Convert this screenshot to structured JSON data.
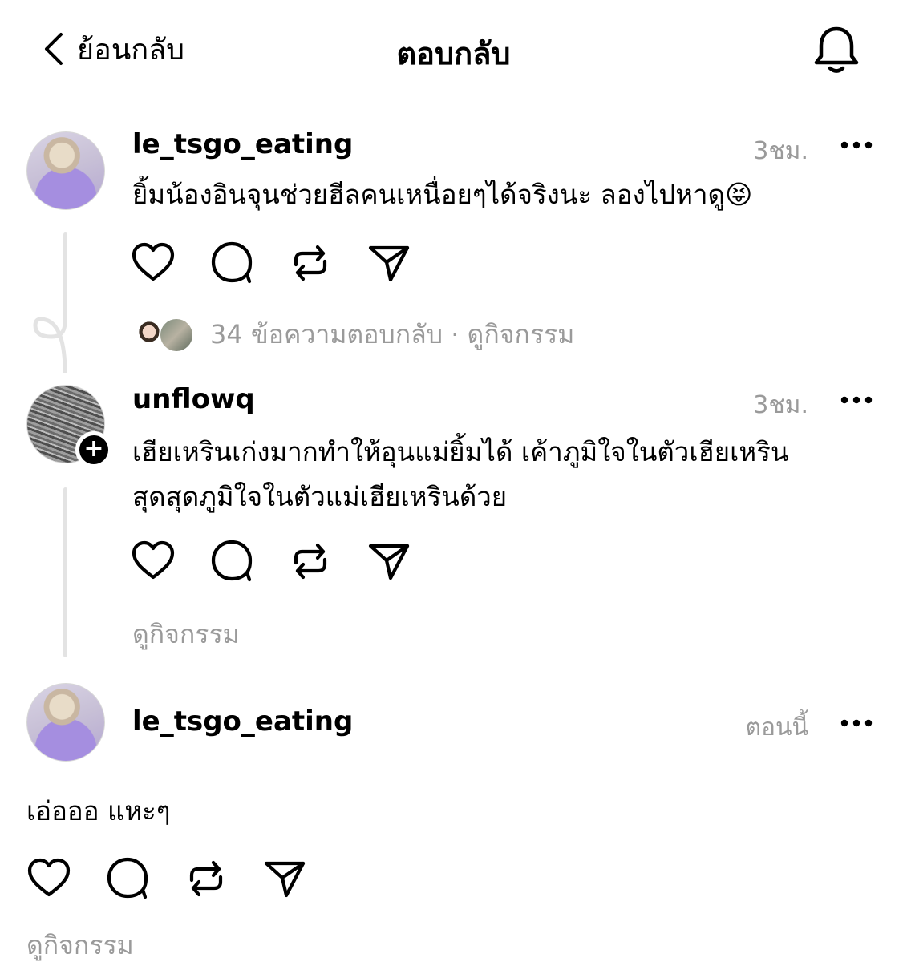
{
  "header": {
    "back_label": "ย้อนกลับ",
    "title": "ตอบกลับ"
  },
  "posts": [
    {
      "username": "le_tsgo_eating",
      "time": "3ชม.",
      "text": "ยิ้มน้องอินจุนช่วยฮีลคนเหนื่อยๆได้จริงนะ ลองไปหาดู😝",
      "replies": "34 ข้อความตอบกลับ · ดูกิจกรรม"
    },
    {
      "username": "unflowq",
      "time": "3ชม.",
      "text_line1": "เฮียเหรินเก่งมากทำให้อุนแม่ยิ้มได้ เค้าภูมิใจในตัวเฮียเหริน",
      "text_line2": "สุดสุดภูมิใจในตัวแม่เฮียเหรินด้วย",
      "activity": "ดูกิจกรรม"
    },
    {
      "username": "le_tsgo_eating",
      "time": "ตอนนี้",
      "text": "เอ่อออ แหะๆ",
      "activity": "ดูกิจกรรม"
    }
  ],
  "icons": [
    "chevron-left-icon",
    "bell-icon",
    "heart-icon",
    "comment-icon",
    "repost-icon",
    "send-icon",
    "more-icon"
  ]
}
